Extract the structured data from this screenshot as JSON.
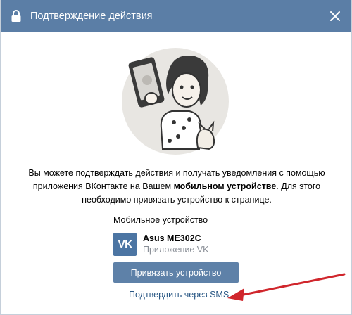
{
  "dialog": {
    "title": "Подтверждение действия",
    "close_icon": "close-icon",
    "lock_icon": "lock-icon"
  },
  "description": {
    "part1": "Вы можете подтверждать действия и получать уведомления с помощью приложения ВКонтакте на Вашем ",
    "bold": "мобильном устройстве",
    "part2": ". Для этого необходимо привязать устройство к странице."
  },
  "device": {
    "section_label": "Мобильное устройство",
    "name": "Asus ME302C",
    "app": "Приложение VK",
    "logo_text": "VK"
  },
  "actions": {
    "bind_label": "Привязать устройство",
    "sms_link": "Подтвердить через SMS"
  },
  "colors": {
    "header": "#5b7ea6",
    "button": "#5e81a8",
    "link": "#2a5885",
    "annotation_arrow": "#d0262c"
  }
}
